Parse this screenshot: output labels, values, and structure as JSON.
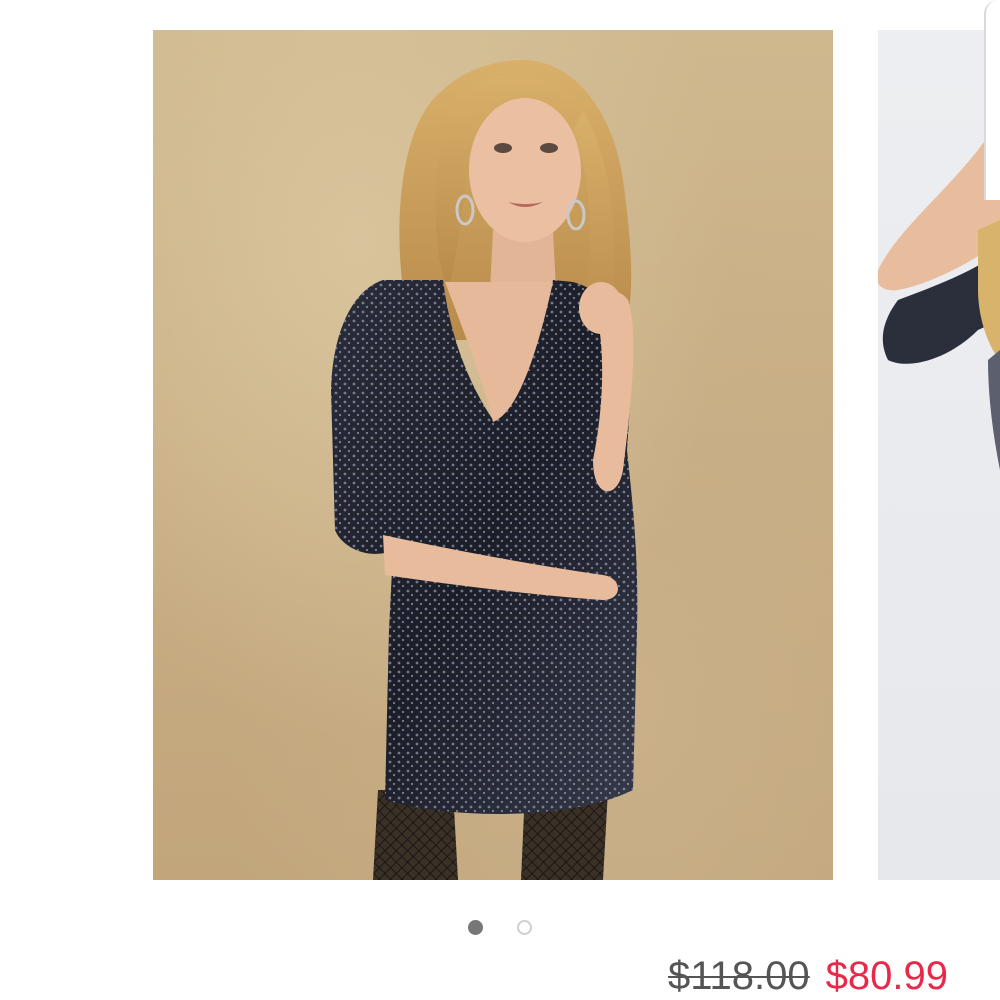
{
  "gallery": {
    "slides": [
      {
        "icon": "model-photo-sequin-dress",
        "background": "#c9b089"
      },
      {
        "icon": "model-photo-partial",
        "background": "#e9ebee"
      }
    ],
    "active_index": 0,
    "dot_count": 2
  },
  "pricing": {
    "original_price": "$118.00",
    "sale_price": "$80.99",
    "sale_color": "#e8294a"
  }
}
